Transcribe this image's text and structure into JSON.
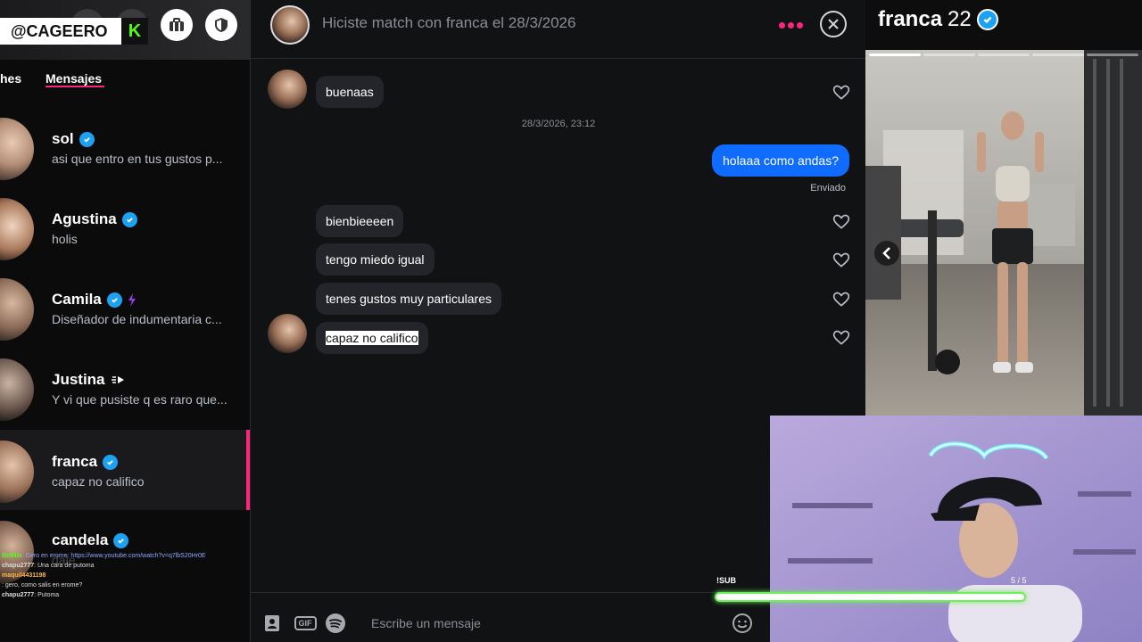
{
  "overlay": {
    "channel_handle": "@CAGEERO",
    "kick_letter": "K"
  },
  "sidebar": {
    "tab_matches": "hes",
    "tab_messages": "Mensajes",
    "conversations": [
      {
        "name": "sol",
        "preview": "asi que entro en tus gustos p...",
        "verified": true
      },
      {
        "name": "Agustina",
        "preview": "holis",
        "verified": true
      },
      {
        "name": "Camila",
        "preview": "Diseñador de indumentaria c...",
        "verified": true
      },
      {
        "name": "Justina",
        "preview": "Y vi que pusiste q es raro que...",
        "verified": false
      },
      {
        "name": "franca",
        "preview": "capaz no califico",
        "verified": true
      },
      {
        "name": "candela",
        "preview": "dale",
        "verified": true
      }
    ]
  },
  "chat_overlay": [
    {
      "user": "",
      "text": ""
    },
    {
      "user": "BotRix",
      "text": ": Gero en erome: https://www.youtube.com/watch?v=q7lbS20Hr0E"
    },
    {
      "user": "",
      "text": ""
    },
    {
      "user": "",
      "text": ""
    },
    {
      "user": "",
      "text": ""
    },
    {
      "user": "chapu2777",
      "text": ": Una cara de putoma"
    },
    {
      "user": "maquil4431198",
      "text": ""
    },
    {
      "user": "",
      "text": ": gero, como salis en erome?"
    },
    {
      "user": "chapu2777",
      "text": ": Putoma"
    }
  ],
  "header": {
    "match_text": "Hiciste match con franca el 28/3/2026"
  },
  "messages": {
    "m1": "buenaas",
    "timestamp": "28/3/2026, 23:12",
    "out1": "holaaa como andas?",
    "sent_label": "Enviado",
    "m2": "bienbieeeen",
    "m3": "tengo miedo igual",
    "m4": "tenes gustos muy particulares",
    "m5": "capaz no califico"
  },
  "composer": {
    "gif_label": "GIF",
    "placeholder": "Escribe un mensaje"
  },
  "profile": {
    "name": "franca",
    "age": "22"
  },
  "stream_widget": {
    "sub_label": "!SUB",
    "sub_count": "5 / 5",
    "progress_fraction": 1.0
  },
  "colors": {
    "accent_pink": "#fd267d",
    "verified_blue": "#1da1f2",
    "outgoing_bubble": "#106bff",
    "kick_green": "#53fc18"
  }
}
